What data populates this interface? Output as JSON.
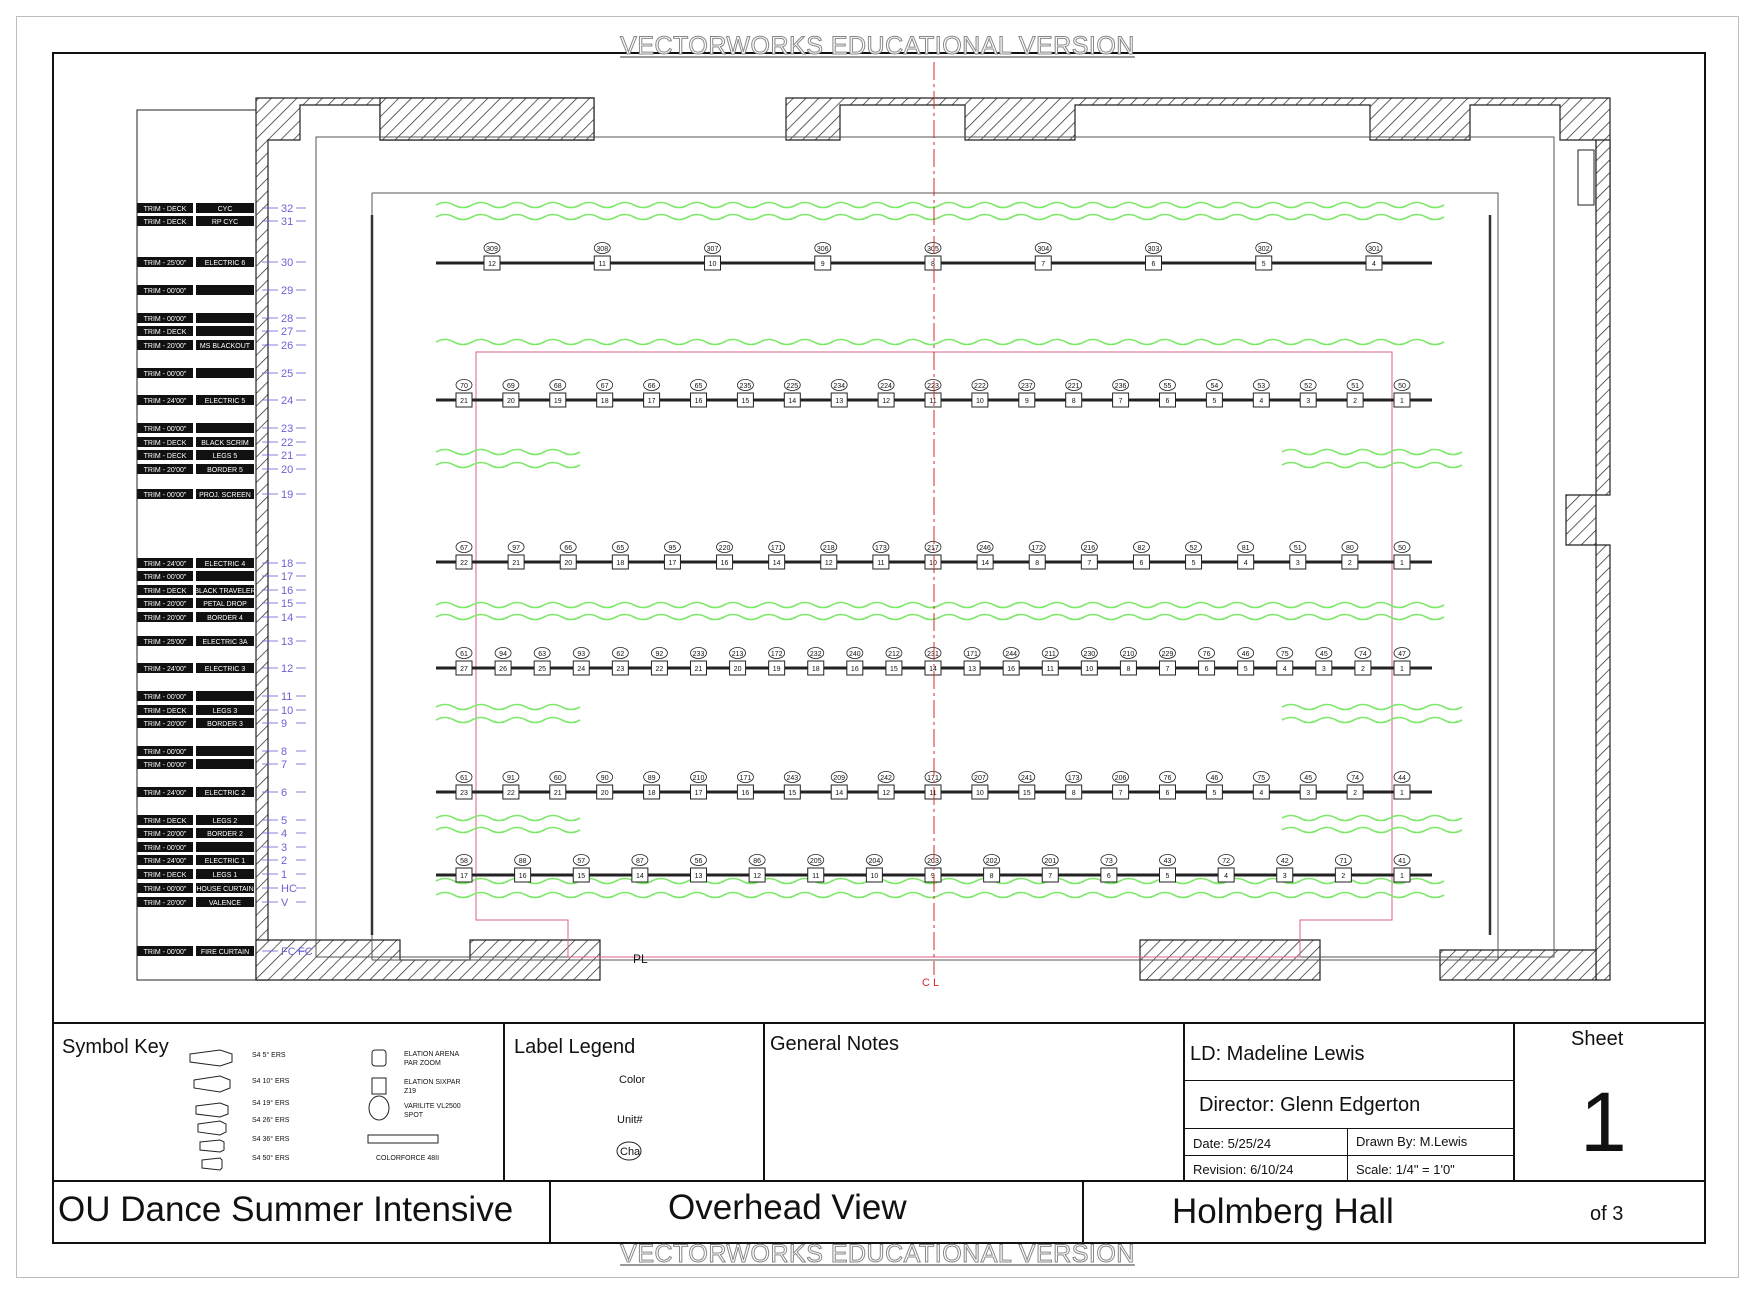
{
  "watermark": "VECTORWORKS EDUCATIONAL VERSION",
  "centerline_label": "C L",
  "plaster_line_label": "PL",
  "fc_label": "FC",
  "colors": {
    "scenery": "#7ee86a",
    "centerline": "#d42a2a",
    "linesets": "#6b63d6",
    "magenta": "#e0608a",
    "ink": "#111111"
  },
  "linesets": [
    {
      "num": "32",
      "trim": "TRIM - DECK",
      "name": "CYC"
    },
    {
      "num": "31",
      "trim": "TRIM - DECK",
      "name": "RP CYC"
    },
    {
      "num": "30",
      "trim": "TRIM - 25'00\"",
      "name": "ELECTRIC 6"
    },
    {
      "num": "29",
      "trim": "TRIM - 00'00\"",
      "name": ""
    },
    {
      "num": "28",
      "trim": "TRIM - 00'00\"",
      "name": ""
    },
    {
      "num": "27",
      "trim": "TRIM - DECK",
      "name": ""
    },
    {
      "num": "26",
      "trim": "TRIM - 20'00\"",
      "name": "MS BLACKOUT"
    },
    {
      "num": "25",
      "trim": "TRIM - 00'00\"",
      "name": ""
    },
    {
      "num": "24",
      "trim": "TRIM - 24'00\"",
      "name": "ELECTRIC 5"
    },
    {
      "num": "23",
      "trim": "TRIM - 00'00\"",
      "name": ""
    },
    {
      "num": "22",
      "trim": "TRIM - DECK",
      "name": "BLACK SCRIM"
    },
    {
      "num": "21",
      "trim": "TRIM - DECK",
      "name": "LEGS 5"
    },
    {
      "num": "20",
      "trim": "TRIM - 20'00\"",
      "name": "BORDER 5"
    },
    {
      "num": "19",
      "trim": "TRIM - 00'00\"",
      "name": "PROJ. SCREEN"
    },
    {
      "num": "18",
      "trim": "TRIM - 24'00\"",
      "name": "ELECTRIC 4"
    },
    {
      "num": "17",
      "trim": "TRIM - 00'00\"",
      "name": ""
    },
    {
      "num": "16",
      "trim": "TRIM - DECK",
      "name": "BLACK TRAVELER"
    },
    {
      "num": "15",
      "trim": "TRIM - 20'00\"",
      "name": "PETAL DROP"
    },
    {
      "num": "14",
      "trim": "TRIM - 20'00\"",
      "name": "BORDER 4"
    },
    {
      "num": "13",
      "trim": "TRIM - 25'00\"",
      "name": "ELECTRIC 3A"
    },
    {
      "num": "12",
      "trim": "TRIM - 24'00\"",
      "name": "ELECTRIC 3"
    },
    {
      "num": "11",
      "trim": "TRIM - 00'00\"",
      "name": ""
    },
    {
      "num": "10",
      "trim": "TRIM - DECK",
      "name": "LEGS 3"
    },
    {
      "num": "9",
      "trim": "TRIM - 20'00\"",
      "name": "BORDER 3"
    },
    {
      "num": "8",
      "trim": "TRIM - 00'00\"",
      "name": ""
    },
    {
      "num": "7",
      "trim": "TRIM - 00'00\"",
      "name": ""
    },
    {
      "num": "6",
      "trim": "TRIM - 24'00\"",
      "name": "ELECTRIC 2"
    },
    {
      "num": "5",
      "trim": "TRIM - DECK",
      "name": "LEGS 2"
    },
    {
      "num": "4",
      "trim": "TRIM - 20'00\"",
      "name": "BORDER 2"
    },
    {
      "num": "3",
      "trim": "TRIM - 00'00\"",
      "name": ""
    },
    {
      "num": "2",
      "trim": "TRIM - 24'00\"",
      "name": "ELECTRIC 1"
    },
    {
      "num": "1",
      "trim": "TRIM - DECK",
      "name": "LEGS 1"
    },
    {
      "num": "HC",
      "trim": "TRIM - 00'00\"",
      "name": "HOUSE CURTAIN"
    },
    {
      "num": "V",
      "trim": "TRIM - 20'00\"",
      "name": "VALENCE"
    },
    {
      "num": "FC",
      "trim": "TRIM - 00'00\"",
      "name": "FIRE CURTAIN"
    }
  ],
  "electrics": [
    {
      "name": "ELECTRIC 6",
      "units": [
        "12",
        "11",
        "10",
        "9",
        "8",
        "7",
        "6",
        "5",
        "4"
      ],
      "channels": [
        "309",
        "308",
        "307",
        "306",
        "305",
        "304",
        "303",
        "302",
        "301"
      ]
    },
    {
      "name": "ELECTRIC 5",
      "units": [
        "21",
        "20",
        "19",
        "18",
        "17",
        "16",
        "15",
        "14",
        "13",
        "12",
        "11",
        "10",
        "9",
        "8",
        "7",
        "6",
        "5",
        "4",
        "3",
        "2",
        "1"
      ],
      "channels": [
        "70",
        "69",
        "68",
        "67",
        "66",
        "65",
        "235",
        "225",
        "234",
        "224",
        "223",
        "222",
        "237",
        "221",
        "236",
        "55",
        "54",
        "53",
        "52",
        "51",
        "50"
      ]
    },
    {
      "name": "ELECTRIC 4",
      "units": [
        "22",
        "21",
        "20",
        "18",
        "17",
        "16",
        "14",
        "12",
        "11",
        "10",
        "14",
        "8",
        "7",
        "6",
        "5",
        "4",
        "3",
        "2",
        "1"
      ],
      "channels": [
        "67",
        "97",
        "66",
        "65",
        "95",
        "220",
        "171",
        "218",
        "173",
        "217",
        "246",
        "172",
        "216",
        "82",
        "52",
        "81",
        "51",
        "80",
        "50"
      ]
    },
    {
      "name": "ELECTRIC 3",
      "units": [
        "27",
        "26",
        "25",
        "24",
        "23",
        "22",
        "21",
        "20",
        "19",
        "18",
        "16",
        "15",
        "14",
        "13",
        "16",
        "11",
        "10",
        "8",
        "7",
        "6",
        "5",
        "4",
        "3",
        "2",
        "1"
      ],
      "channels": [
        "61",
        "94",
        "63",
        "93",
        "62",
        "92",
        "233",
        "213",
        "172",
        "232",
        "240",
        "212",
        "231",
        "171",
        "244",
        "211",
        "230",
        "210",
        "229",
        "76",
        "46",
        "75",
        "45",
        "74",
        "47"
      ]
    },
    {
      "name": "ELECTRIC 2",
      "units": [
        "23",
        "22",
        "21",
        "20",
        "18",
        "17",
        "16",
        "15",
        "14",
        "12",
        "11",
        "10",
        "15",
        "8",
        "7",
        "6",
        "5",
        "4",
        "3",
        "2",
        "1"
      ],
      "channels": [
        "61",
        "91",
        "60",
        "90",
        "89",
        "210",
        "171",
        "243",
        "209",
        "242",
        "171",
        "207",
        "241",
        "173",
        "206",
        "76",
        "46",
        "75",
        "45",
        "74",
        "44"
      ]
    },
    {
      "name": "ELECTRIC 1",
      "units": [
        "17",
        "16",
        "15",
        "14",
        "13",
        "12",
        "11",
        "10",
        "9",
        "8",
        "7",
        "6",
        "5",
        "4",
        "3",
        "2",
        "1"
      ],
      "channels": [
        "58",
        "88",
        "57",
        "87",
        "56",
        "86",
        "205",
        "204",
        "203",
        "202",
        "201",
        "73",
        "43",
        "72",
        "42",
        "71",
        "41"
      ]
    }
  ],
  "symbol_key": {
    "title": "Symbol Key",
    "items": [
      "S4 5° ERS",
      "S4 10° ERS",
      "S4 19° ERS",
      "S4 26° ERS",
      "S4 36° ERS",
      "S4 50° ERS"
    ],
    "fixtures": [
      "ELATION ARENA PAR ZOOM",
      "ELATION SIXPAR Z19",
      "VARILITE VL2500 SPOT",
      "COLORFORCE 48II"
    ]
  },
  "label_legend": {
    "title": "Label Legend",
    "color": "Color",
    "unit": "Unit#",
    "channel": "Cha"
  },
  "general_notes": {
    "title": "General Notes"
  },
  "credits": {
    "ld": "LD: Madeline Lewis",
    "director": "Director: Glenn Edgerton",
    "date": "Date: 5/25/24",
    "drawn_by": "Drawn By: M.Lewis",
    "revision": "Revision: 6/10/24",
    "scale": "Scale: 1/4\" = 1'0\""
  },
  "sheet": {
    "label": "Sheet",
    "number": "1",
    "of": "of 3"
  },
  "production": "OU Dance Summer Intensive",
  "view": "Overhead View",
  "venue": "Holmberg Hall"
}
